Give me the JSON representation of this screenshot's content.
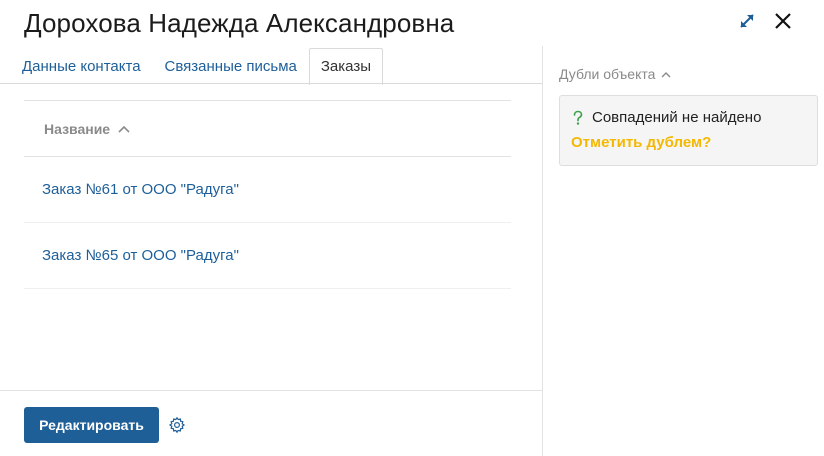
{
  "header": {
    "title": "Дорохова Надежда Александровна"
  },
  "tabs": [
    {
      "label": "Данные контакта",
      "active": false
    },
    {
      "label": "Связанные письма",
      "active": false
    },
    {
      "label": "Заказы",
      "active": true
    }
  ],
  "table": {
    "column_header": "Название",
    "rows": [
      {
        "label": "Заказ №61 от ООО \"Радуга\""
      },
      {
        "label": "Заказ №65 от ООО \"Радуга\""
      }
    ]
  },
  "footer": {
    "edit_label": "Редактировать"
  },
  "duplicates": {
    "header": "Дубли объекта",
    "status": "Совпадений не найдено",
    "mark_link": "Отметить дублем?"
  },
  "icons": {
    "expand": "expand-icon",
    "close": "close-icon",
    "sort": "chevron-up-icon",
    "settings": "gear-icon",
    "collapse": "chevron-up-icon",
    "question": "question-icon"
  },
  "colors": {
    "accent": "#1f5f97",
    "link": "#1e5f99",
    "warning_link": "#f5b800",
    "success_icon": "#3aa14a"
  }
}
